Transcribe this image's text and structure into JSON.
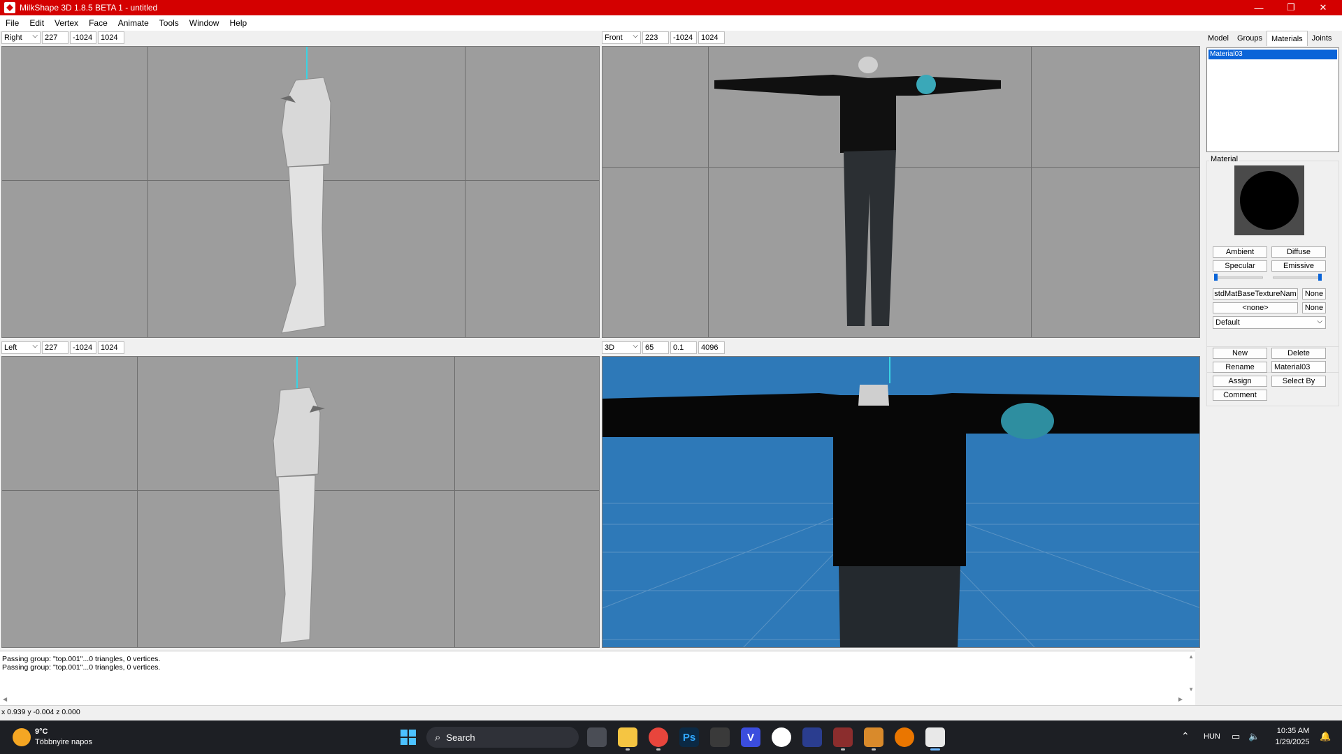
{
  "window": {
    "title": "MilkShape 3D 1.8.5 BETA 1 - untitled",
    "controls": [
      "—",
      "❐",
      "✕"
    ]
  },
  "menu": [
    "File",
    "Edit",
    "Vertex",
    "Face",
    "Animate",
    "Tools",
    "Window",
    "Help"
  ],
  "viewports": [
    {
      "view": "Right",
      "v1": "227",
      "v2": "-1024",
      "v3": "1024"
    },
    {
      "view": "Front",
      "v1": "223",
      "v2": "-1024",
      "v3": "1024"
    },
    {
      "view": "Left",
      "v1": "227",
      "v2": "-1024",
      "v3": "1024"
    },
    {
      "view": "3D",
      "v1": "65",
      "v2": "0.1",
      "v3": "4096"
    }
  ],
  "panel": {
    "tabs": [
      "Model",
      "Groups",
      "Materials",
      "Joints"
    ],
    "active_tab": "Materials",
    "materials": [
      "Material03"
    ],
    "material_group_label": "Material",
    "buttons": {
      "ambient": "Ambient",
      "diffuse": "Diffuse",
      "specular": "Specular",
      "emissive": "Emissive",
      "texture_name": "stdMatBaseTextureNam",
      "texture_none": "None",
      "alpha_map": "<none>",
      "alpha_none": "None",
      "new": "New",
      "delete": "Delete",
      "rename": "Rename",
      "assign": "Assign",
      "select_by": "Select By",
      "comment": "Comment"
    },
    "mode_dropdown": "Default",
    "material_name": "Material03",
    "shininess_level": 0.0,
    "transparency_level": 1.0
  },
  "log": [
    "Passing group: \"top.001\"...0 triangles, 0 vertices.",
    "Passing group: \"top.001\"...0 triangles, 0 vertices."
  ],
  "status": "x 0.939 y -0.004 z 0.000",
  "taskbar": {
    "weather_temp": "9°C",
    "weather_desc": "Többnyire napos",
    "search": "Search",
    "language": "HUN",
    "time": "10:35 AM",
    "date": "1/29/2025"
  },
  "colors": {
    "titlebar": "#d40000",
    "viewport_bg": "#9d9d9d",
    "viewport_3d_bg": "#2e79b8",
    "selection": "#0a64d8",
    "axis": "#3ad3e3"
  }
}
